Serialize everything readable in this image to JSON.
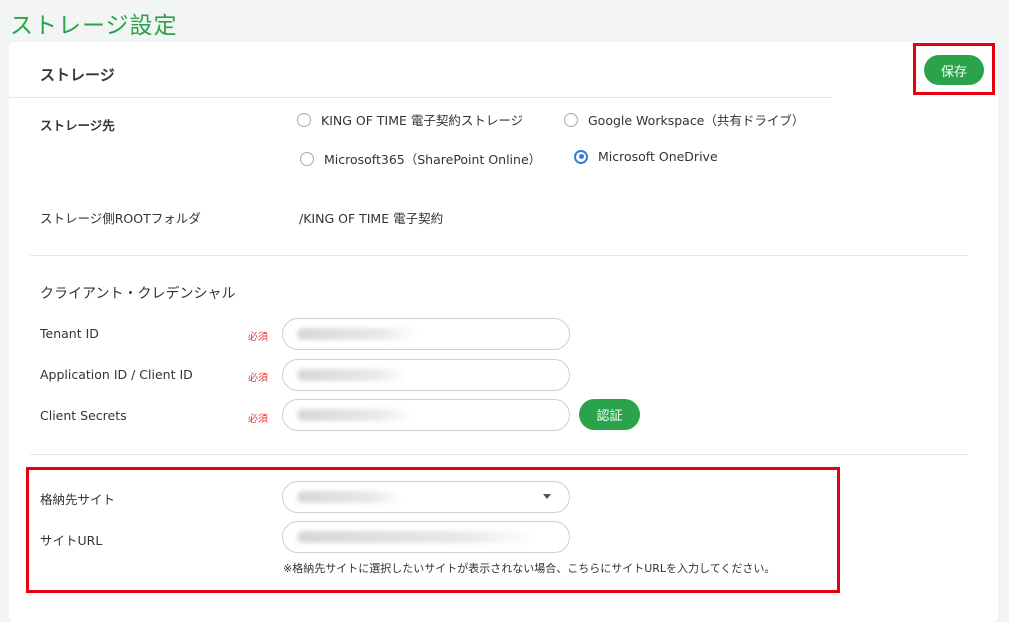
{
  "page": {
    "title": "ストレージ設定"
  },
  "storage": {
    "section_title": "ストレージ",
    "save_label": "保存",
    "destination_label": "ストレージ先",
    "options": [
      {
        "label": "KING OF TIME 電子契約ストレージ",
        "checked": false
      },
      {
        "label": "Google Workspace（共有ドライブ）",
        "checked": false
      },
      {
        "label": "Microsoft365（SharePoint Online）",
        "checked": false
      },
      {
        "label": "Microsoft OneDrive",
        "checked": true
      }
    ],
    "root_folder_label": "ストレージ側ROOTフォルダ",
    "root_folder_value": "/KING OF TIME 電子契約"
  },
  "credentials": {
    "title": "クライアント・クレデンシャル",
    "required_label": "必須",
    "tenant_id_label": "Tenant ID",
    "application_id_label": "Application ID / Client ID",
    "client_secrets_label": "Client Secrets",
    "auth_button_label": "認証"
  },
  "site": {
    "site_label": "格納先サイト",
    "site_url_label": "サイトURL",
    "hint": "※格納先サイトに選択したいサイトが表示されない場合、こちらにサイトURLを入力してください。"
  },
  "colors": {
    "accent": "#2aa34a",
    "highlight": "#e60012",
    "radio": "#3a7bd5",
    "required": "#e03a3a"
  }
}
